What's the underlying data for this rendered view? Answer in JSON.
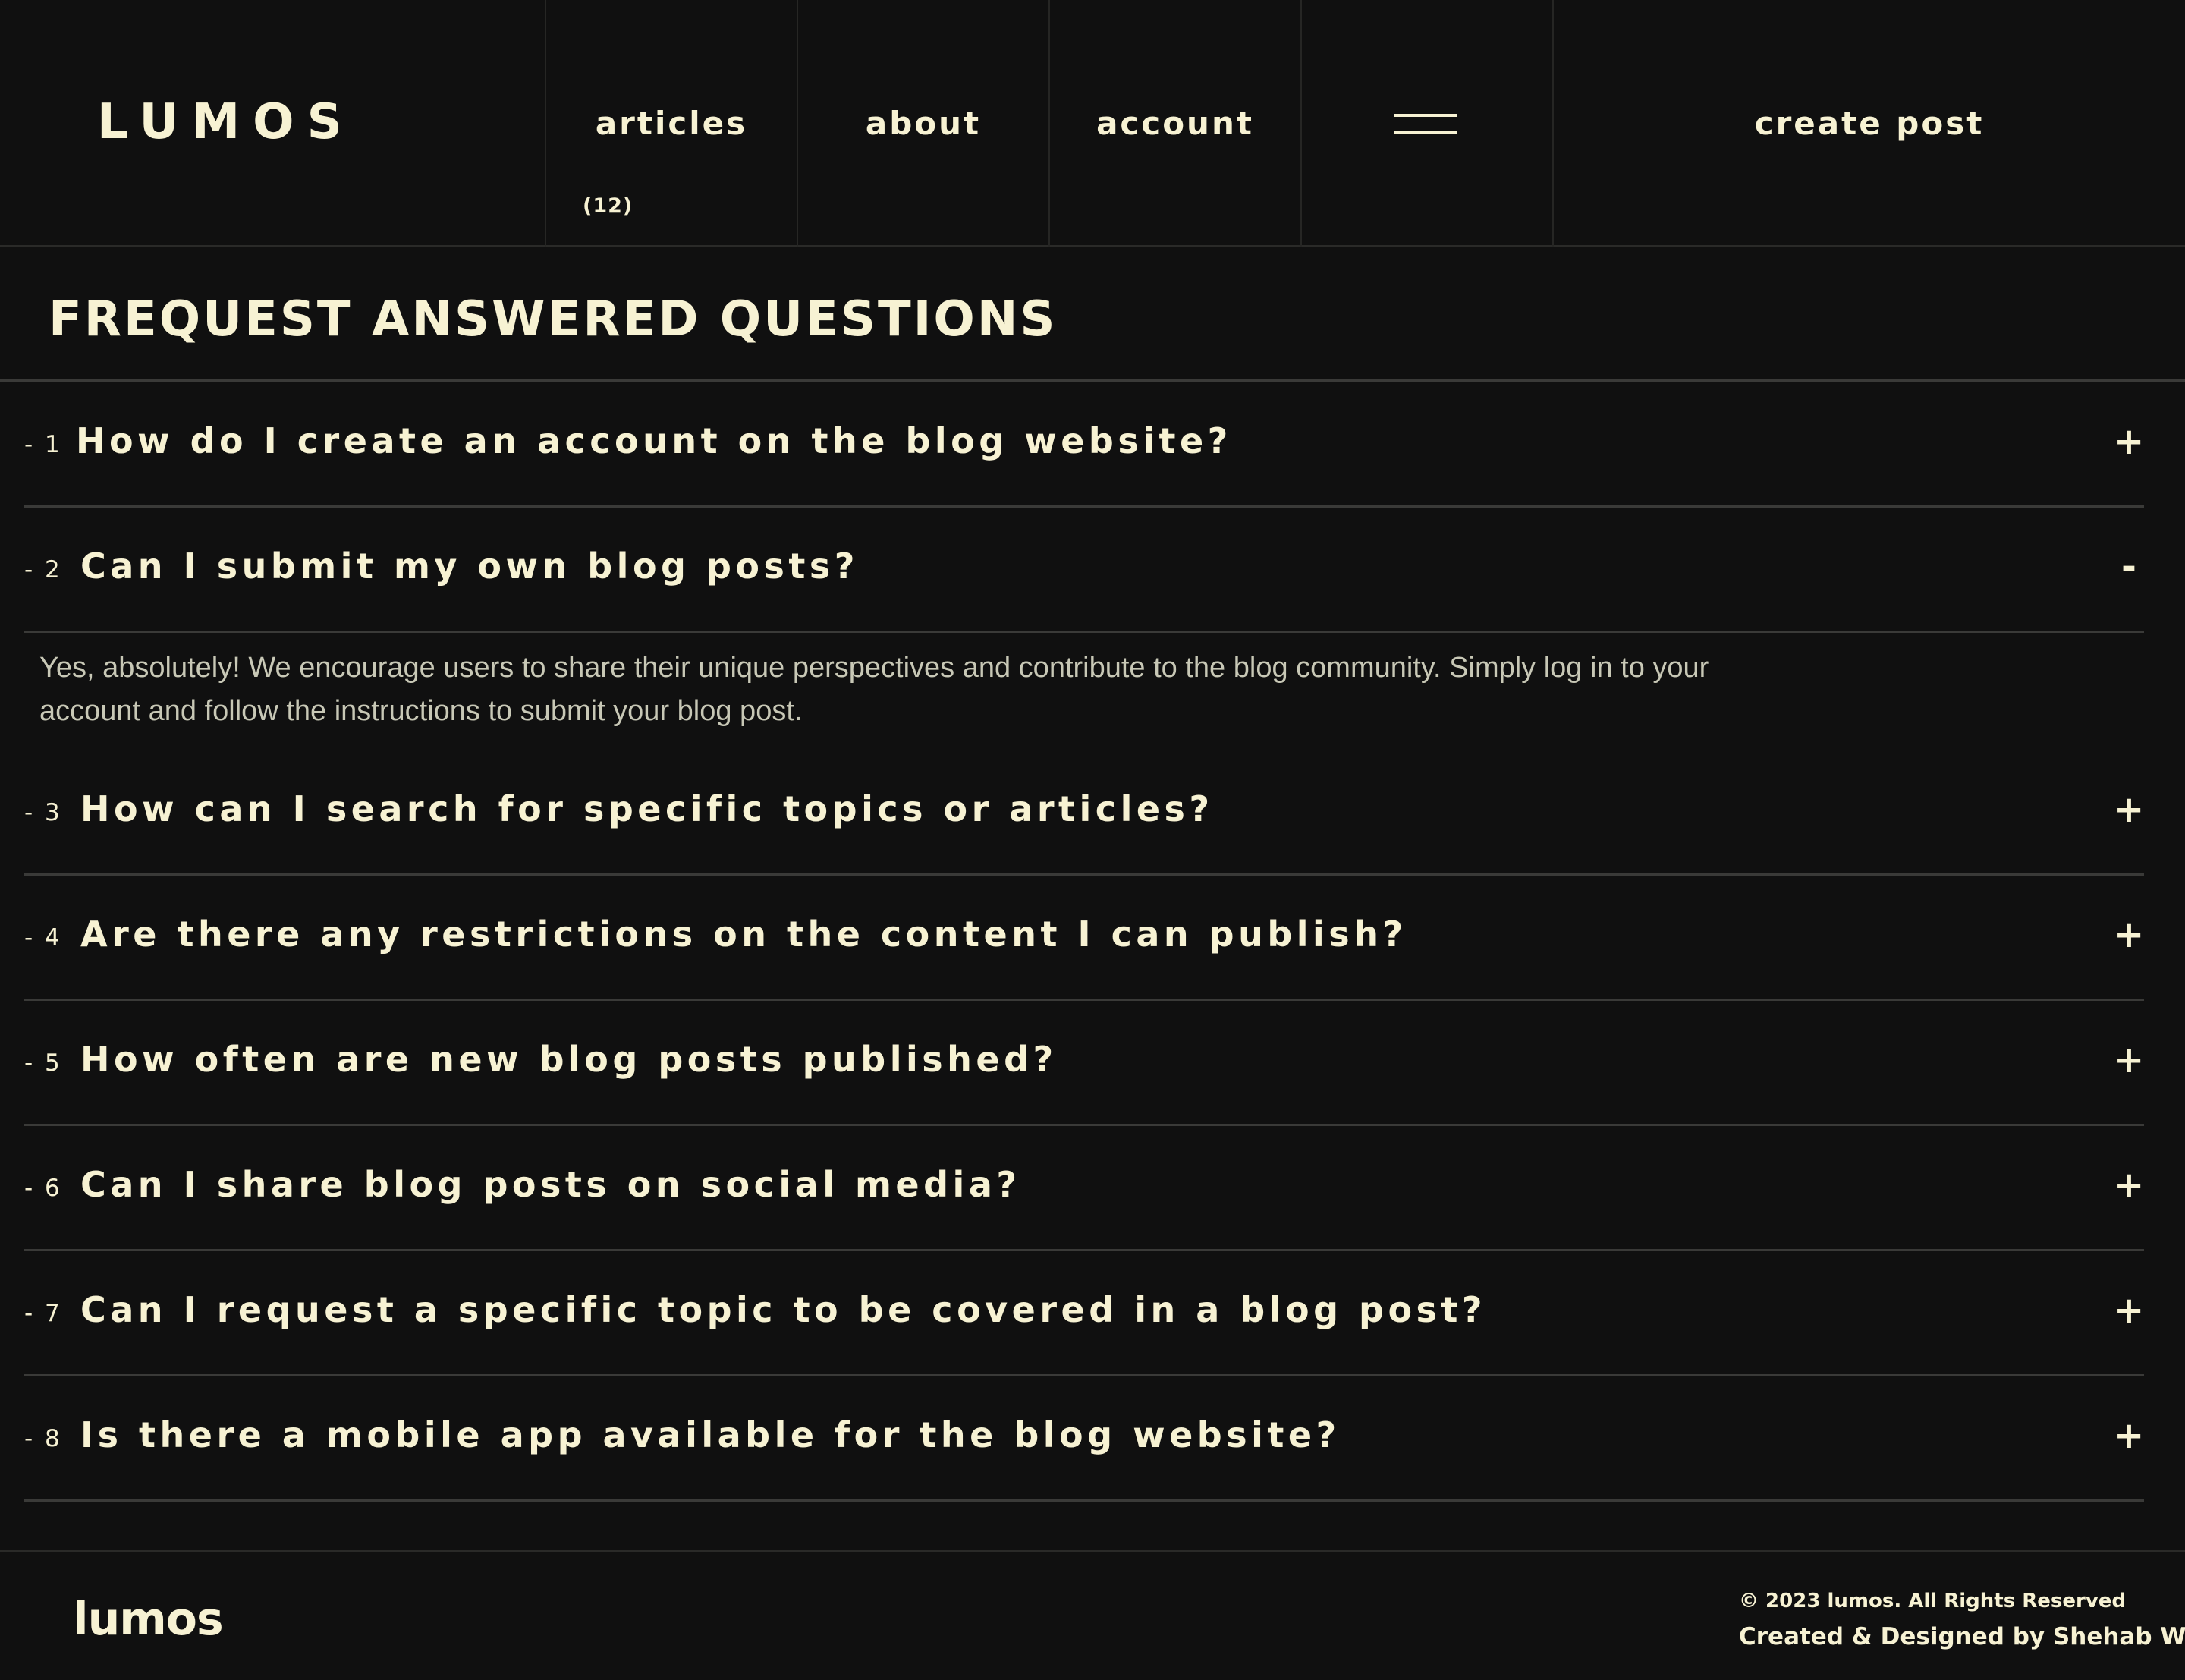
{
  "header": {
    "brand": "LUMOS",
    "nav": {
      "articles_label": "articles",
      "articles_count": "(12)",
      "about_label": "about",
      "account_label": "account",
      "menu_icon": "menu-icon",
      "create_post_label": "create post"
    }
  },
  "main": {
    "title": "FREQUEST ANSWERED QUESTIONS",
    "faqs": [
      {
        "number": "- 1",
        "question": "How do I create an account on the blog website?",
        "toggle": "+"
      },
      {
        "number": "- 2",
        "question": "Can I submit my own blog posts?",
        "toggle": "-",
        "answer": "Yes, absolutely! We encourage users to share their unique perspectives and contribute to the blog community. Simply log in to your account and follow the instructions to submit your blog post."
      },
      {
        "number": "- 3",
        "question": "How can I search for specific topics or articles?",
        "toggle": "+"
      },
      {
        "number": "- 4",
        "question": "Are there any restrictions on the content I can publish?",
        "toggle": "+"
      },
      {
        "number": "- 5",
        "question": "How often are new blog posts published?",
        "toggle": "+"
      },
      {
        "number": "- 6",
        "question": "Can I share blog posts on social media?",
        "toggle": "+"
      },
      {
        "number": "- 7",
        "question": "Can I request a specific topic to be covered in a blog post?",
        "toggle": "+"
      },
      {
        "number": "- 8",
        "question": "Is there a mobile app available for the blog website?",
        "toggle": "+"
      }
    ]
  },
  "footer": {
    "logo": "lumos",
    "copyright": "© 2023 lumos. All Rights Reserved",
    "credit": "Created & Designed by Shehab Waleed"
  },
  "colors": {
    "background": "#101010",
    "text": "#f7f2d3",
    "answer_text": "#c8c8b6",
    "divider": "#3a3a38"
  }
}
